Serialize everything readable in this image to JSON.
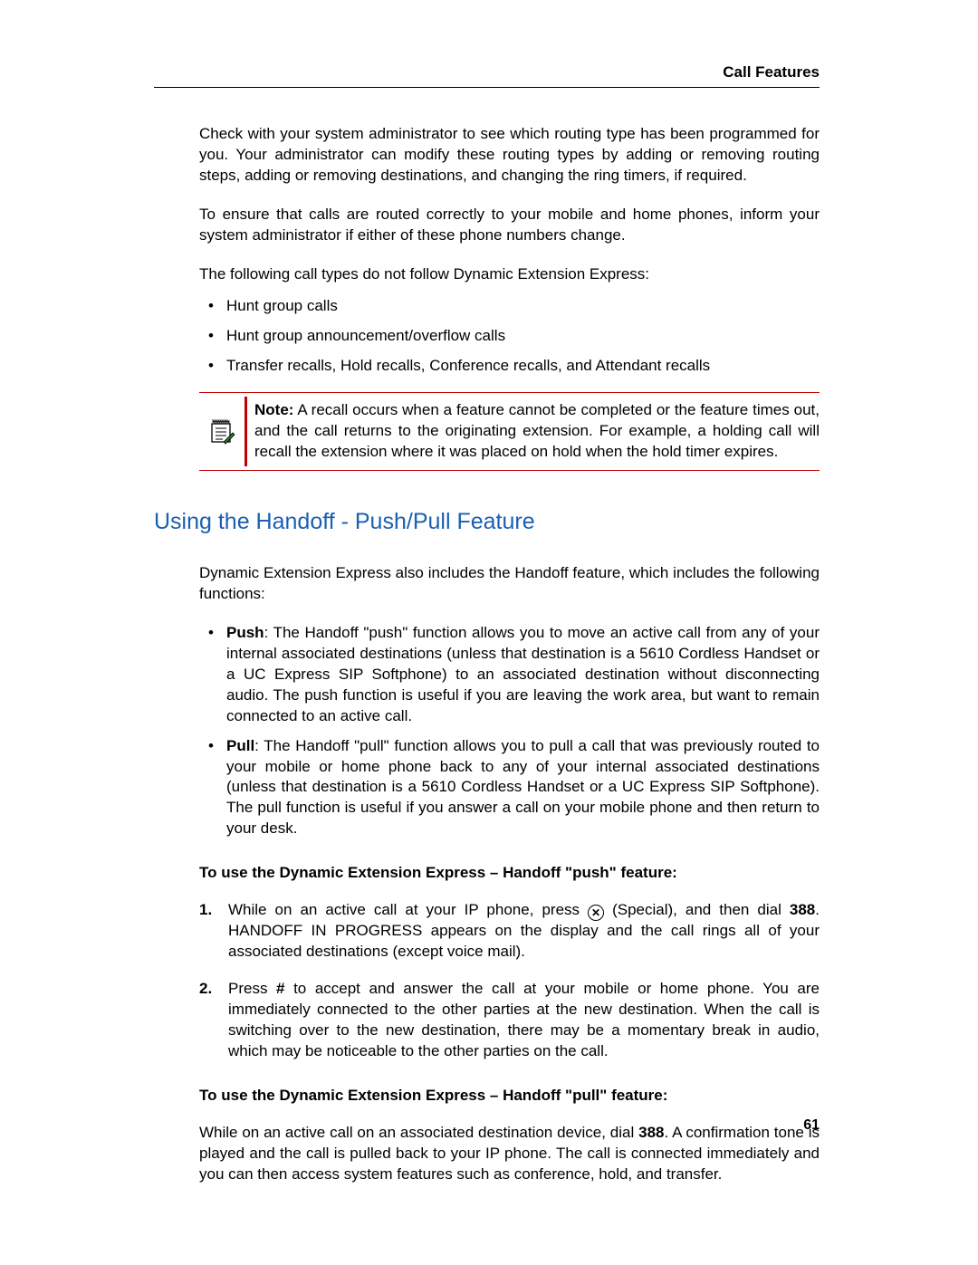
{
  "header": {
    "title": "Call Features"
  },
  "intro": {
    "p1": "Check with your system administrator to see which routing type has been programmed for you. Your administrator can modify these routing types by adding or removing routing steps, adding or removing destinations, and changing the ring timers, if required.",
    "p2": "To ensure that calls are routed correctly to your mobile and home phones, inform your system administrator if either of these phone numbers change.",
    "p3": "The following call types do not follow Dynamic Extension Express:"
  },
  "bullets1": [
    "Hunt group calls",
    "Hunt group announcement/overflow calls",
    "Transfer recalls, Hold recalls, Conference recalls, and Attendant recalls"
  ],
  "note": {
    "label": "Note:",
    "text": " A recall occurs when a feature cannot be completed or the feature times out, and the call returns to the originating extension. For example, a holding call will recall the extension where it was placed on hold when the hold timer expires."
  },
  "section": {
    "heading": "Using the Handoff - Push/Pull Feature",
    "intro": "Dynamic Extension Express also includes the Handoff feature, which includes the following functions:",
    "push": {
      "label": "Push",
      "text": ": The Handoff \"push\" function allows you to move an active call from any of your internal associated destinations (unless that destination is a 5610 Cordless Handset or a UC Express SIP Softphone) to an associated destination without disconnecting audio. The push function is useful if you are leaving the work area, but want to remain connected to an active call."
    },
    "pull": {
      "label": "Pull",
      "text": ": The Handoff \"pull\" function allows you to pull a call that was previously routed to your mobile or home phone back to any of your internal associated destinations (unless that destination is a 5610 Cordless Handset or a UC Express SIP Softphone). The pull function is useful if you answer a call on your mobile phone and then return to your desk."
    },
    "push_heading": "To use the Dynamic Extension Express – Handoff \"push\" feature:",
    "steps": {
      "s1a": "While on an active call at your IP phone, press ",
      "s1b": " (Special), and then dial ",
      "s1num": "388",
      "s1c": ". HANDOFF IN PROGRESS appears on the display and the call rings all of your associated destinations (except voice mail).",
      "s2a": "Press ",
      "s2hash": "#",
      "s2b": " to accept and answer the call at your mobile or home phone. You are immediately connected to the other parties at the new destination. When the call is switching over to the new destination, there may be a momentary break in audio, which may be noticeable to the other parties on the call."
    },
    "pull_heading": "To use the Dynamic Extension Express – Handoff \"pull\" feature:",
    "pull_p_a": "While on an active call on an associated destination device, dial ",
    "pull_p_num": "388",
    "pull_p_b": ". A confirmation tone is played and the call is pulled back to your IP phone. The call is connected immediately and you can then access system features such as conference, hold, and transfer."
  },
  "page_number": "61"
}
